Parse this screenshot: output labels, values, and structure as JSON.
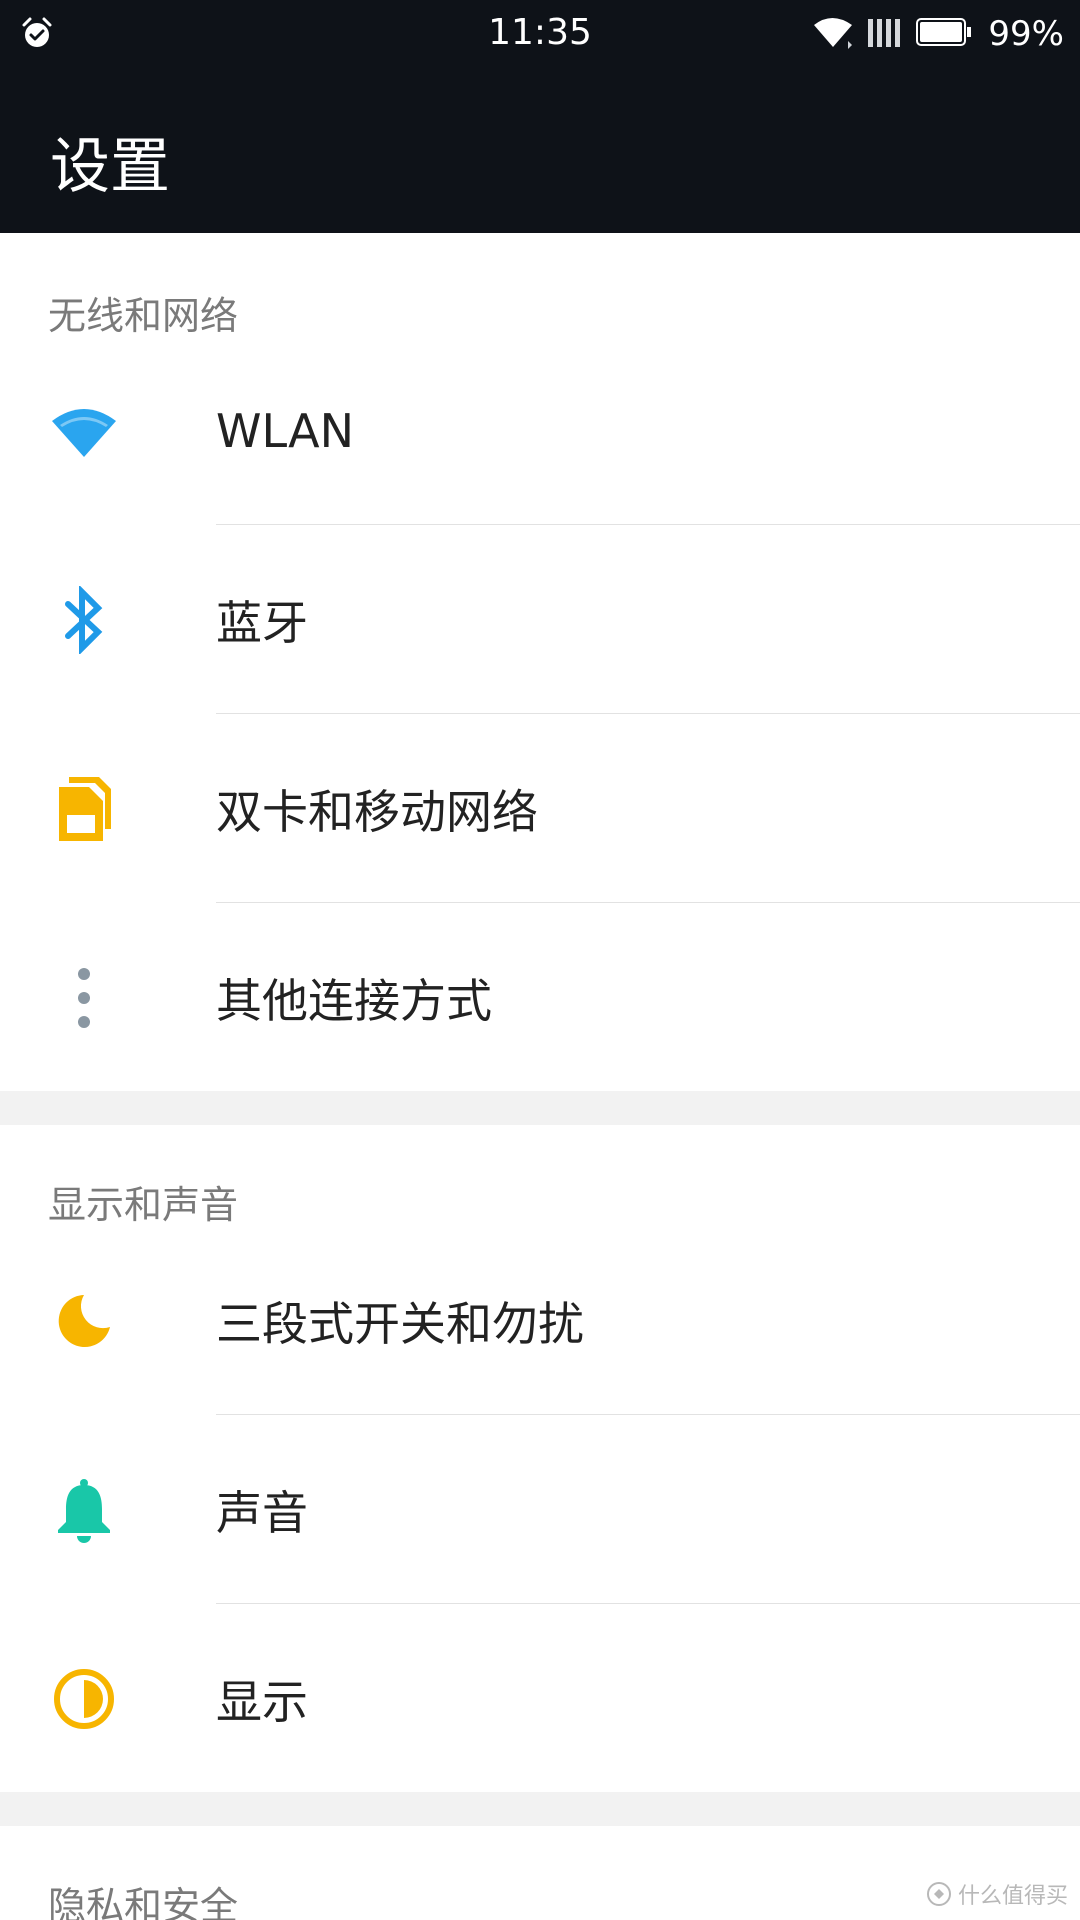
{
  "status_bar": {
    "time": "11:35",
    "battery_percent": "99%",
    "icons": [
      "alarm-icon",
      "wifi-icon",
      "signal-icon",
      "battery-icon"
    ]
  },
  "header": {
    "title": "设置"
  },
  "sections": [
    {
      "title": "无线和网络",
      "items": [
        {
          "label": "WLAN",
          "icon": "wifi-icon",
          "icon_color": "#2aa5ef"
        },
        {
          "label": "蓝牙",
          "icon": "bluetooth-icon",
          "icon_color": "#1f9ae8"
        },
        {
          "label": "双卡和移动网络",
          "icon": "sim-card-icon",
          "icon_color": "#f7b500"
        },
        {
          "label": "其他连接方式",
          "icon": "more-vertical-icon",
          "icon_color": "#8a97a2"
        }
      ]
    },
    {
      "title": "显示和声音",
      "items": [
        {
          "label": "三段式开关和勿扰",
          "icon": "moon-icon",
          "icon_color": "#f7b500"
        },
        {
          "label": "声音",
          "icon": "bell-icon",
          "icon_color": "#19c7a8"
        },
        {
          "label": "显示",
          "icon": "brightness-icon",
          "icon_color": "#f7b500"
        }
      ]
    },
    {
      "title": "隐私和安全",
      "items": []
    }
  ],
  "watermark": {
    "text": "什么值得买"
  }
}
